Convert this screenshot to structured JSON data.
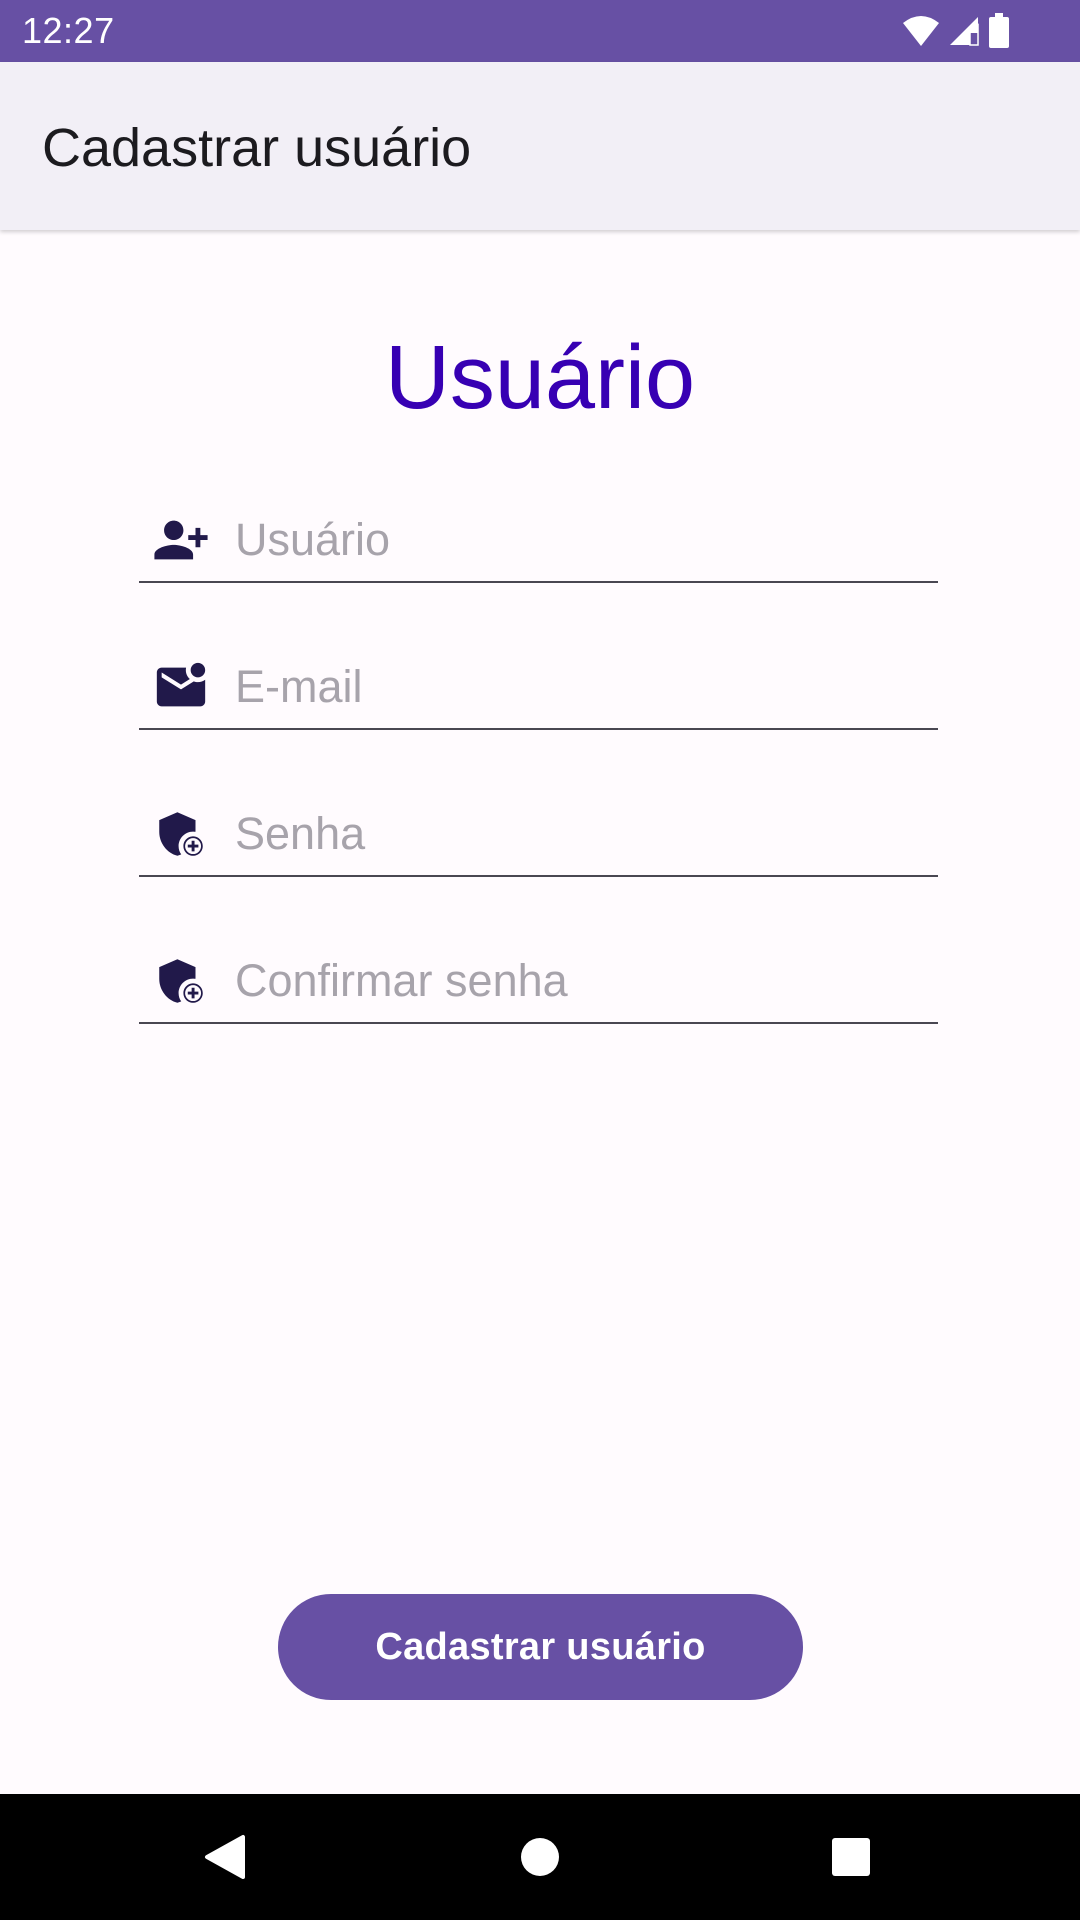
{
  "status_bar": {
    "time": "12:27",
    "icons": [
      "wifi-icon",
      "cell-signal-icon",
      "battery-icon"
    ],
    "color": "#6750a4"
  },
  "app_bar": {
    "title": "Cadastrar usuário"
  },
  "form": {
    "heading": "Usuário",
    "fields": [
      {
        "icon": "person-add-icon",
        "placeholder": "Usuário",
        "value": ""
      },
      {
        "icon": "mark-email-unread-icon",
        "placeholder": "E-mail",
        "value": ""
      },
      {
        "icon": "add-moderator-icon",
        "placeholder": "Senha",
        "value": ""
      },
      {
        "icon": "add-moderator-icon",
        "placeholder": "Confirmar senha",
        "value": ""
      }
    ],
    "submit_label": "Cadastrar usuário"
  },
  "nav_bar": {
    "buttons": [
      "back-icon",
      "home-icon",
      "recents-icon"
    ]
  },
  "colors": {
    "primary": "#6750a4",
    "heading": "#3700b3",
    "icon": "#21194a",
    "background": "#fffbfe"
  }
}
